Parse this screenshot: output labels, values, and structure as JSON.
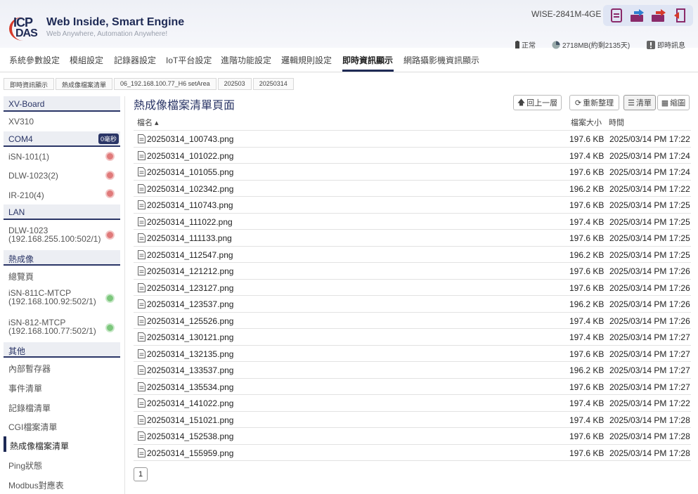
{
  "brand": {
    "logo_top": "ICP",
    "logo_bottom": "DAS",
    "title": "Web Inside, Smart Engine",
    "subtitle": "Web Anywhere, Automation Anywhere!"
  },
  "header": {
    "model": "WISE-2841M-4GE",
    "icons": [
      "document-icon",
      "upload-icon",
      "download-icon",
      "logout-icon"
    ],
    "status": {
      "battery": "正常",
      "storage": "2718MB(約剩2135天)",
      "info": "即時訊息"
    }
  },
  "menu": [
    "系統參數設定",
    "模組設定",
    "記錄器設定",
    "IoT平台設定",
    "進階功能設定",
    "邏輯規則設定",
    "即時資訊顯示",
    "網路攝影機資訊顯示"
  ],
  "breadcrumb": [
    "即時資訊顯示",
    "熱成像檔案清單",
    "06_192.168.100.77_H6 setArea",
    "202503",
    "20250314"
  ],
  "sidebar": {
    "sections": {
      "xvboard": "XV-Board",
      "com4": "COM4",
      "lan": "LAN",
      "thermal": "熱成像",
      "other": "其他"
    },
    "com4_badge": "0毫秒",
    "xv310": "XV310",
    "com_items": [
      "iSN-101(1)",
      "DLW-1023(2)",
      "IR-210(4)"
    ],
    "lan_item": {
      "name": "DLW-1023",
      "ip": "(192.168.255.100:502/1)"
    },
    "thermal_overview": "總覽頁",
    "thermal_items": [
      {
        "name": "iSN-811C-MTCP",
        "ip": "(192.168.100.92:502/1)"
      },
      {
        "name": "iSN-812-MTCP",
        "ip": "(192.168.100.77:502/1)"
      }
    ],
    "other_items": [
      "內部暫存器",
      "事件清單",
      "記錄檔清單",
      "CGI檔案清單",
      "熱成像檔案清單",
      "Ping狀態",
      "Modbus對應表"
    ]
  },
  "main": {
    "title": "熱成像檔案清單頁面",
    "buttons": {
      "up": "回上一層",
      "refresh": "重新整理",
      "list": "清單",
      "thumb": "縮圖"
    },
    "columns": {
      "name": "檔名 ▴",
      "size": "檔案大小",
      "time": "時間"
    },
    "files": [
      {
        "name": "20250314_100743.png",
        "size": "197.6 KB",
        "time": "2025/03/14 PM 17:22"
      },
      {
        "name": "20250314_101022.png",
        "size": "197.4 KB",
        "time": "2025/03/14 PM 17:24"
      },
      {
        "name": "20250314_101055.png",
        "size": "197.6 KB",
        "time": "2025/03/14 PM 17:24"
      },
      {
        "name": "20250314_102342.png",
        "size": "196.2 KB",
        "time": "2025/03/14 PM 17:22"
      },
      {
        "name": "20250314_110743.png",
        "size": "197.6 KB",
        "time": "2025/03/14 PM 17:25"
      },
      {
        "name": "20250314_111022.png",
        "size": "197.4 KB",
        "time": "2025/03/14 PM 17:25"
      },
      {
        "name": "20250314_111133.png",
        "size": "197.6 KB",
        "time": "2025/03/14 PM 17:25"
      },
      {
        "name": "20250314_112547.png",
        "size": "196.2 KB",
        "time": "2025/03/14 PM 17:25"
      },
      {
        "name": "20250314_121212.png",
        "size": "197.6 KB",
        "time": "2025/03/14 PM 17:26"
      },
      {
        "name": "20250314_123127.png",
        "size": "197.6 KB",
        "time": "2025/03/14 PM 17:26"
      },
      {
        "name": "20250314_123537.png",
        "size": "196.2 KB",
        "time": "2025/03/14 PM 17:26"
      },
      {
        "name": "20250314_125526.png",
        "size": "197.4 KB",
        "time": "2025/03/14 PM 17:26"
      },
      {
        "name": "20250314_130121.png",
        "size": "197.4 KB",
        "time": "2025/03/14 PM 17:27"
      },
      {
        "name": "20250314_132135.png",
        "size": "197.6 KB",
        "time": "2025/03/14 PM 17:27"
      },
      {
        "name": "20250314_133537.png",
        "size": "196.2 KB",
        "time": "2025/03/14 PM 17:27"
      },
      {
        "name": "20250314_135534.png",
        "size": "197.6 KB",
        "time": "2025/03/14 PM 17:27"
      },
      {
        "name": "20250314_141022.png",
        "size": "197.4 KB",
        "time": "2025/03/14 PM 17:22"
      },
      {
        "name": "20250314_151021.png",
        "size": "197.4 KB",
        "time": "2025/03/14 PM 17:28"
      },
      {
        "name": "20250314_152538.png",
        "size": "197.6 KB",
        "time": "2025/03/14 PM 17:28"
      },
      {
        "name": "20250314_155959.png",
        "size": "197.6 KB",
        "time": "2025/03/14 PM 17:28"
      }
    ],
    "page": "1"
  },
  "colors": {
    "navy": "#1e2a55",
    "accent_red": "#d63a2a",
    "status_red": "#e07a7a",
    "status_green": "#7cc77c"
  }
}
